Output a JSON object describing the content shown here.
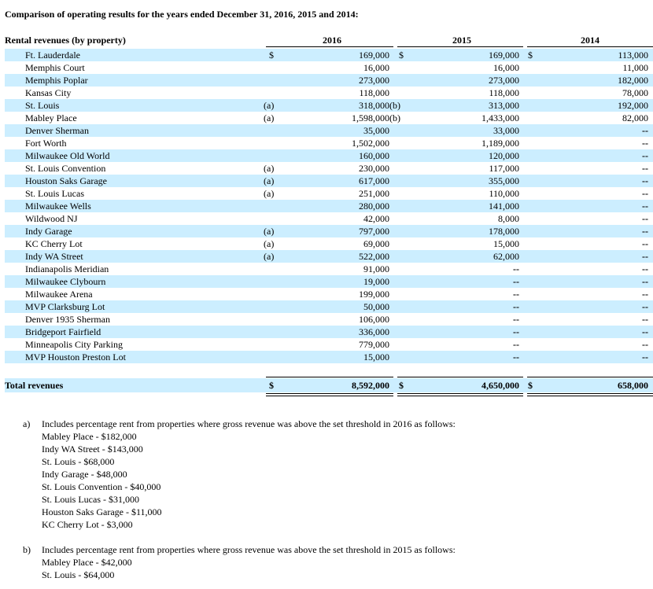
{
  "title": "Comparison of operating results for the years ended December 31, 2016, 2015 and 2014:",
  "header": {
    "label": "Rental revenues (by property)",
    "years": [
      "2016",
      "2015",
      "2014"
    ]
  },
  "currency_symbol": "$",
  "rows": [
    {
      "name": "Ft. Lauderdale",
      "note": "",
      "v2016": "169,000",
      "suf": "",
      "v2015": "169,000",
      "v2014": "113,000",
      "dollar": true
    },
    {
      "name": "Memphis Court",
      "note": "",
      "v2016": "16,000",
      "suf": "",
      "v2015": "16,000",
      "v2014": "11,000"
    },
    {
      "name": "Memphis Poplar",
      "note": "",
      "v2016": "273,000",
      "suf": "",
      "v2015": "273,000",
      "v2014": "182,000"
    },
    {
      "name": "Kansas City",
      "note": "",
      "v2016": "118,000",
      "suf": "",
      "v2015": "118,000",
      "v2014": "78,000"
    },
    {
      "name": "St. Louis",
      "note": "(a)",
      "v2016": "318,000",
      "suf": "(b)",
      "v2015": "313,000",
      "v2014": "192,000"
    },
    {
      "name": "Mabley Place",
      "note": "(a)",
      "v2016": "1,598,000",
      "suf": "(b)",
      "v2015": "1,433,000",
      "v2014": "82,000"
    },
    {
      "name": "Denver Sherman",
      "note": "",
      "v2016": "35,000",
      "suf": "",
      "v2015": "33,000",
      "v2014": "--"
    },
    {
      "name": "Fort Worth",
      "note": "",
      "v2016": "1,502,000",
      "suf": "",
      "v2015": "1,189,000",
      "v2014": "--"
    },
    {
      "name": "Milwaukee Old World",
      "note": "",
      "v2016": "160,000",
      "suf": "",
      "v2015": "120,000",
      "v2014": "--"
    },
    {
      "name": "St. Louis Convention",
      "note": "(a)",
      "v2016": "230,000",
      "suf": "",
      "v2015": "117,000",
      "v2014": "--"
    },
    {
      "name": "Houston Saks Garage",
      "note": "(a)",
      "v2016": "617,000",
      "suf": "",
      "v2015": "355,000",
      "v2014": "--"
    },
    {
      "name": "St. Louis Lucas",
      "note": "(a)",
      "v2016": "251,000",
      "suf": "",
      "v2015": "110,000",
      "v2014": "--"
    },
    {
      "name": "Milwaukee Wells",
      "note": "",
      "v2016": "280,000",
      "suf": "",
      "v2015": "141,000",
      "v2014": "--"
    },
    {
      "name": "Wildwood NJ",
      "note": "",
      "v2016": "42,000",
      "suf": "",
      "v2015": "8,000",
      "v2014": "--"
    },
    {
      "name": "Indy Garage",
      "note": "(a)",
      "v2016": "797,000",
      "suf": "",
      "v2015": "178,000",
      "v2014": "--"
    },
    {
      "name": "KC Cherry Lot",
      "note": "(a)",
      "v2016": "69,000",
      "suf": "",
      "v2015": "15,000",
      "v2014": "--"
    },
    {
      "name": "Indy WA Street",
      "note": "(a)",
      "v2016": "522,000",
      "suf": "",
      "v2015": "62,000",
      "v2014": "--"
    },
    {
      "name": "Indianapolis Meridian",
      "note": "",
      "v2016": "91,000",
      "suf": "",
      "v2015": "--",
      "v2014": "--"
    },
    {
      "name": "Milwaukee Clybourn",
      "note": "",
      "v2016": "19,000",
      "suf": "",
      "v2015": "--",
      "v2014": "--"
    },
    {
      "name": "Milwaukee Arena",
      "note": "",
      "v2016": "199,000",
      "suf": "",
      "v2015": "--",
      "v2014": "--"
    },
    {
      "name": "MVP Clarksburg Lot",
      "note": "",
      "v2016": "50,000",
      "suf": "",
      "v2015": "--",
      "v2014": "--"
    },
    {
      "name": "Denver 1935 Sherman",
      "note": "",
      "v2016": "106,000",
      "suf": "",
      "v2015": "--",
      "v2014": "--"
    },
    {
      "name": "Bridgeport Fairfield",
      "note": "",
      "v2016": "336,000",
      "suf": "",
      "v2015": "--",
      "v2014": "--"
    },
    {
      "name": "Minneapolis City Parking",
      "note": "",
      "v2016": "779,000",
      "suf": "",
      "v2015": "--",
      "v2014": "--"
    },
    {
      "name": "MVP Houston Preston Lot",
      "note": "",
      "v2016": "15,000",
      "suf": "",
      "v2015": "--",
      "v2014": "--"
    }
  ],
  "total": {
    "label": "Total revenues",
    "v2016": "8,592,000",
    "v2015": "4,650,000",
    "v2014": "658,000"
  },
  "footnotes": [
    {
      "marker": "a)",
      "text": "Includes percentage rent from properties where gross revenue was above the set threshold in 2016 as follows:",
      "items": [
        "Mabley Place - $182,000",
        "Indy WA Street - $143,000",
        "St. Louis - $68,000",
        "Indy Garage - $48,000",
        "St. Louis Convention - $40,000",
        "St. Louis Lucas - $31,000",
        "Houston Saks Garage - $11,000",
        "KC Cherry Lot - $3,000"
      ]
    },
    {
      "marker": "b)",
      "text": "Includes percentage rent from properties where gross revenue was above the set threshold in 2015 as follows:",
      "items": [
        "Mabley Place - $42,000",
        "St. Louis - $64,000"
      ]
    }
  ]
}
